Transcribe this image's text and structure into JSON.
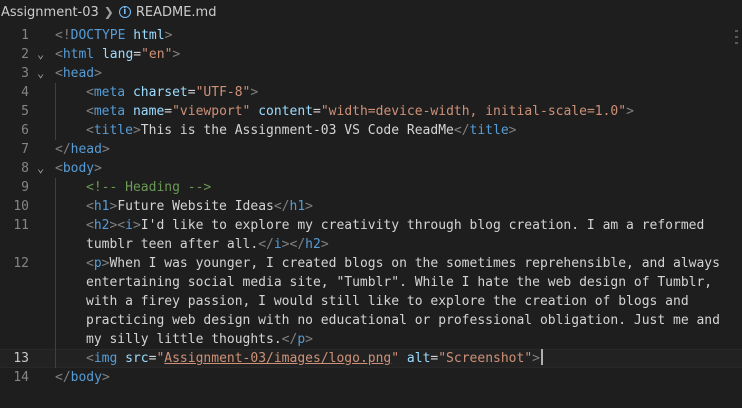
{
  "breadcrumb": {
    "folder": "Assignment-03",
    "file": "README.md",
    "file_icon": "info-icon"
  },
  "editor": {
    "lines": [
      {
        "n": "1",
        "fold": "",
        "segs": [
          [
            "t-br",
            "<!"
          ],
          [
            "t-tag",
            "DOCTYPE"
          ],
          [
            "t-txt",
            " "
          ],
          [
            "t-attr",
            "html"
          ],
          [
            "t-br",
            ">"
          ]
        ]
      },
      {
        "n": "2",
        "fold": "⌄",
        "segs": [
          [
            "t-br",
            "<"
          ],
          [
            "t-tag",
            "html"
          ],
          [
            "t-txt",
            " "
          ],
          [
            "t-attr",
            "lang"
          ],
          [
            "t-txt",
            "="
          ],
          [
            "t-str",
            "\"en\""
          ],
          [
            "t-br",
            ">"
          ]
        ]
      },
      {
        "n": "3",
        "fold": "⌄",
        "segs": [
          [
            "t-br",
            "<"
          ],
          [
            "t-tag",
            "head"
          ],
          [
            "t-br",
            ">"
          ]
        ]
      },
      {
        "n": "4",
        "fold": "",
        "indent": 1,
        "segs": [
          [
            "t-br",
            "<"
          ],
          [
            "t-tag",
            "meta"
          ],
          [
            "t-txt",
            " "
          ],
          [
            "t-attr",
            "charset"
          ],
          [
            "t-txt",
            "="
          ],
          [
            "t-str",
            "\"UTF-8\""
          ],
          [
            "t-br",
            ">"
          ]
        ]
      },
      {
        "n": "5",
        "fold": "",
        "indent": 1,
        "segs": [
          [
            "t-br",
            "<"
          ],
          [
            "t-tag",
            "meta"
          ],
          [
            "t-txt",
            " "
          ],
          [
            "t-attr",
            "name"
          ],
          [
            "t-txt",
            "="
          ],
          [
            "t-str",
            "\"viewport\""
          ],
          [
            "t-txt",
            " "
          ],
          [
            "t-attr",
            "content"
          ],
          [
            "t-txt",
            "="
          ],
          [
            "t-str",
            "\"width=device-width, initial-scale=1.0\""
          ],
          [
            "t-br",
            ">"
          ]
        ]
      },
      {
        "n": "6",
        "fold": "",
        "indent": 1,
        "segs": [
          [
            "t-br",
            "<"
          ],
          [
            "t-tag",
            "title"
          ],
          [
            "t-br",
            ">"
          ],
          [
            "t-txt",
            "This is the Assignment-03 VS Code ReadMe"
          ],
          [
            "t-br",
            "</"
          ],
          [
            "t-tag",
            "title"
          ],
          [
            "t-br",
            ">"
          ]
        ]
      },
      {
        "n": "7",
        "fold": "",
        "segs": [
          [
            "t-br",
            "</"
          ],
          [
            "t-tag",
            "head"
          ],
          [
            "t-br",
            ">"
          ]
        ]
      },
      {
        "n": "8",
        "fold": "⌄",
        "segs": [
          [
            "t-br",
            "<"
          ],
          [
            "t-tag",
            "body"
          ],
          [
            "t-br",
            ">"
          ]
        ]
      },
      {
        "n": "9",
        "fold": "",
        "indent": 1,
        "segs": [
          [
            "t-cmt",
            "<!-- Heading -->"
          ]
        ]
      },
      {
        "n": "10",
        "fold": "",
        "indent": 1,
        "segs": [
          [
            "t-br",
            "<"
          ],
          [
            "t-tag",
            "h1"
          ],
          [
            "t-br",
            ">"
          ],
          [
            "t-txt",
            "Future Website Ideas"
          ],
          [
            "t-br",
            "</"
          ],
          [
            "t-tag",
            "h1"
          ],
          [
            "t-br",
            ">"
          ]
        ]
      },
      {
        "n": "11",
        "fold": "",
        "indent": 1,
        "segs": [
          [
            "t-br",
            "<"
          ],
          [
            "t-tag",
            "h2"
          ],
          [
            "t-br",
            "><"
          ],
          [
            "t-tag",
            "i"
          ],
          [
            "t-br",
            ">"
          ],
          [
            "t-txt",
            "I'd like to explore my creativity through blog creation. I am a reformed"
          ]
        ]
      },
      {
        "n": "",
        "fold": "",
        "indent": 1,
        "segs": [
          [
            "t-txt",
            "tumblr teen after all."
          ],
          [
            "t-br",
            "</"
          ],
          [
            "t-tag",
            "i"
          ],
          [
            "t-br",
            "></"
          ],
          [
            "t-tag",
            "h2"
          ],
          [
            "t-br",
            ">"
          ]
        ]
      },
      {
        "n": "12",
        "fold": "",
        "indent": 1,
        "segs": [
          [
            "t-br",
            "<"
          ],
          [
            "t-tag",
            "p"
          ],
          [
            "t-br",
            ">"
          ],
          [
            "t-txt",
            "When I was younger, I created blogs on the sometimes reprehensible, and always"
          ]
        ]
      },
      {
        "n": "",
        "fold": "",
        "indent": 1,
        "segs": [
          [
            "t-txt",
            "entertaining social media site, \"Tumblr\". While I hate the web design of Tumblr,"
          ]
        ]
      },
      {
        "n": "",
        "fold": "",
        "indent": 1,
        "segs": [
          [
            "t-txt",
            "with a firey passion, I would still like to explore the creation of blogs and"
          ]
        ]
      },
      {
        "n": "",
        "fold": "",
        "indent": 1,
        "segs": [
          [
            "t-txt",
            "practicing web design with no educational or professional obligation. Just me and"
          ]
        ]
      },
      {
        "n": "",
        "fold": "",
        "indent": 1,
        "segs": [
          [
            "t-txt",
            "my silly little thoughts."
          ],
          [
            "t-br",
            "</"
          ],
          [
            "t-tag",
            "p"
          ],
          [
            "t-br",
            ">"
          ]
        ]
      },
      {
        "n": "13",
        "fold": "",
        "indent": 1,
        "current": true,
        "segs": [
          [
            "t-br",
            "<"
          ],
          [
            "t-tag",
            "img"
          ],
          [
            "t-txt",
            " "
          ],
          [
            "t-attr",
            "src"
          ],
          [
            "t-txt",
            "="
          ],
          [
            "t-str",
            "\""
          ],
          [
            "t-str u",
            "Assignment-03/images/logo.png"
          ],
          [
            "t-str",
            "\""
          ],
          [
            "t-txt",
            " "
          ],
          [
            "t-attr",
            "alt"
          ],
          [
            "t-txt",
            "="
          ],
          [
            "t-str",
            "\"Screenshot\""
          ],
          [
            "t-br",
            ">"
          ]
        ]
      },
      {
        "n": "14",
        "fold": "",
        "segs": [
          [
            "t-br",
            "</"
          ],
          [
            "t-tag",
            "body"
          ],
          [
            "t-br",
            ">"
          ]
        ]
      }
    ]
  }
}
